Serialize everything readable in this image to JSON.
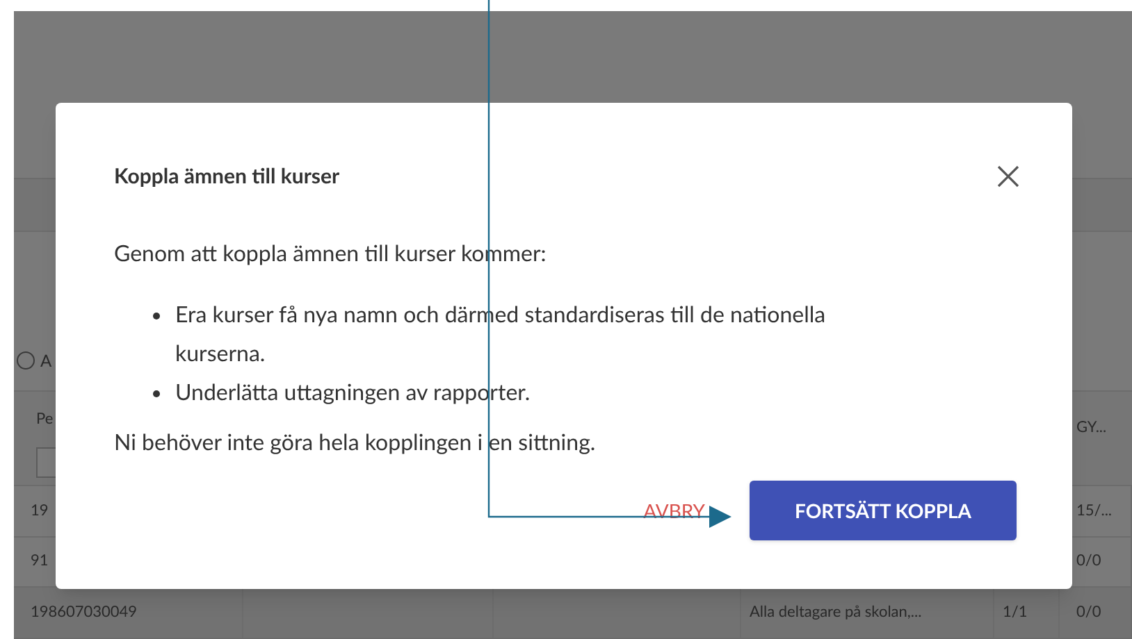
{
  "background": {
    "radio_selected": false,
    "radio_label": "A",
    "columns": [
      "Pe",
      "GY..."
    ],
    "rows": [
      {
        "cells": [
          "19",
          "",
          "",
          "",
          "",
          "15/..."
        ]
      },
      {
        "cells": [
          "91",
          "",
          "",
          "",
          "",
          "0/0"
        ]
      },
      {
        "cells": [
          "198607030049",
          "",
          "",
          "Alla deltagare på skolan,...",
          "1/1",
          "0/0"
        ]
      }
    ]
  },
  "dialog": {
    "title": "Koppla ämnen till kurser",
    "intro": "Genom att koppla ämnen till kurser kommer:",
    "bullets": [
      "Era kurser få nya namn och därmed standardiseras till de nationella kurserna.",
      "Underlätta uttagningen av rapporter."
    ],
    "note": "Ni behöver inte göra hela kopplingen i en sittning.",
    "cancel": "AVBRY",
    "confirm": "FORTSÄTT KOPPLA"
  }
}
